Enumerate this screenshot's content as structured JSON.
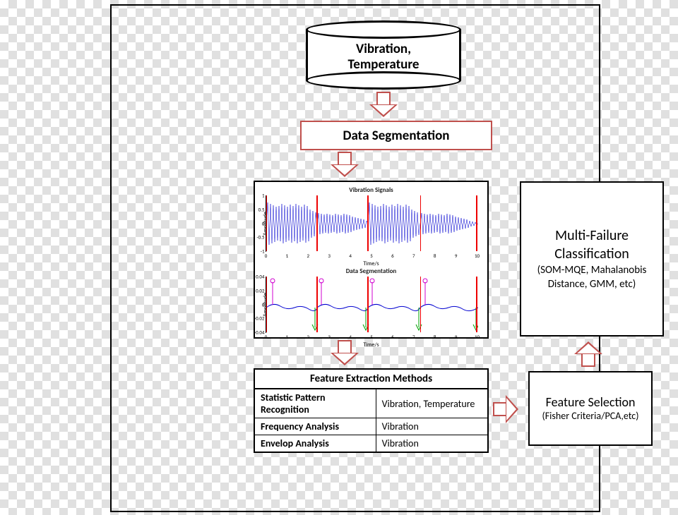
{
  "db": {
    "line1": "Vibration,",
    "line2": "Temperature"
  },
  "data_seg": "Data Segmentation",
  "plot": {
    "title1": "Vibration Signals",
    "title2": "Data Segmentation",
    "xlabel": "Time/s",
    "ylabel": "Amplitude",
    "yticks1": [
      "1",
      "0.5",
      "0",
      "-0.5",
      "-1"
    ],
    "yticks2": [
      "0.04",
      "0.02",
      "0",
      "-0.02",
      "-0.04"
    ],
    "xticks": [
      "0",
      "1",
      "2",
      "3",
      "4",
      "5",
      "6",
      "7",
      "8",
      "9",
      "10"
    ]
  },
  "table": {
    "header": "Feature Extraction Methods",
    "rows": [
      {
        "method": "Statistic Pattern Recognition",
        "data": "Vibration, Temperature"
      },
      {
        "method": "Frequency Analysis",
        "data": "Vibration"
      },
      {
        "method": "Envelop Analysis",
        "data": "Vibration"
      }
    ]
  },
  "feat_sel": {
    "title": "Feature Selection",
    "sub": "(Fisher Criteria/PCA,etc)"
  },
  "multi_fail": {
    "title1": "Multi-Failure",
    "title2": "Classification",
    "sub": "(SOM-MQE, Mahalanobis Distance, GMM, etc)"
  },
  "chart_data": [
    {
      "type": "line",
      "title": "Vibration Signals",
      "xlabel": "Time/s",
      "ylabel": "Amplitude",
      "xlim": [
        0,
        10
      ],
      "ylim": [
        -1,
        1
      ],
      "segment_boundaries": [
        0,
        2.4,
        4.8,
        7.3,
        10
      ],
      "note": "Dense noisy vibration waveform; segment amplitudes roughly [0.9, 0.6, 0.9, 0.6] peak."
    },
    {
      "type": "line",
      "title": "Data Segmentation",
      "xlabel": "Time/s",
      "ylabel": "Amplitude",
      "xlim": [
        0,
        10
      ],
      "ylim": [
        -0.04,
        0.04
      ],
      "segment_boundaries": [
        0,
        2.4,
        4.8,
        7.3,
        10
      ],
      "markers_up_x": [
        0.3,
        2.6,
        5.0,
        7.5
      ],
      "markers_down_x": [
        2.3,
        4.7,
        7.2,
        9.9
      ],
      "note": "Low-amplitude envelope trace with magenta up-markers at segment starts and green down-markers at segment ends."
    }
  ]
}
